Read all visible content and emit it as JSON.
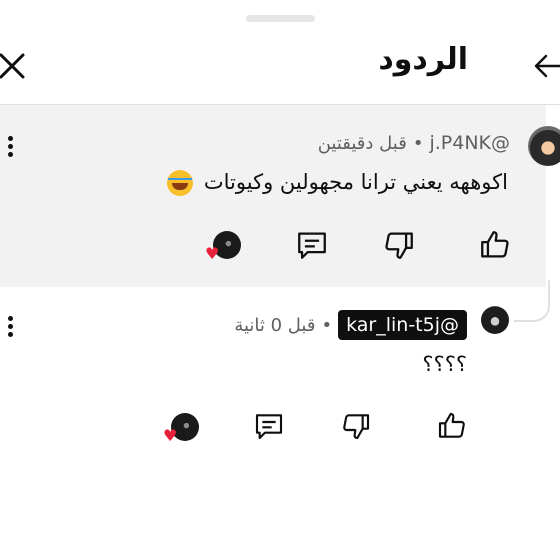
{
  "header": {
    "title": "الردود"
  },
  "comments": [
    {
      "handle": "@j.P4NK",
      "time": "قبل دقيقتين",
      "text": "اكوههه يعني ترانا مجهولين وكيوتات"
    },
    {
      "handle": "@kar_lin-t5j",
      "time": "قبل 0 ثانية",
      "text": "؟؟؟؟"
    }
  ],
  "icons": [
    "close-icon",
    "back-arrow-icon",
    "more-vert-icon",
    "like-icon",
    "dislike-icon",
    "reply-icon",
    "creator-heart-icon",
    "laughing-emoji-icon"
  ]
}
